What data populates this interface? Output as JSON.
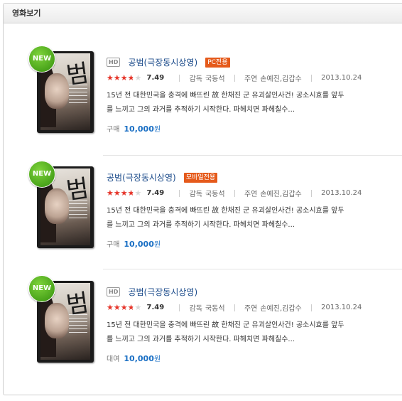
{
  "panel": {
    "title": "영화보기"
  },
  "colors": {
    "star": "#e8352a",
    "new_badge": "#4aa41b",
    "tag": "#e55a1b",
    "link": "#1a4a8a",
    "price": "#1a6fc4"
  },
  "items": [
    {
      "badge": "NEW",
      "hd": "HD",
      "title": "공범(극장동시상영)",
      "tag": "PC전용",
      "rating": 7.49,
      "rating_text": "7.49",
      "director_label": "감독",
      "director": "국동석",
      "cast_label": "주연",
      "cast": "손예진,김갑수",
      "date": "2013.10.24",
      "desc_line1": "15년 전 대한민국을 충격에 빠뜨린 故 한채진 군 유괴살인사건! 공소시효를 앞두",
      "desc_line2": "를 느끼고 그의 과거를 추적하기 시작한다. 파헤치면 파헤칠수...",
      "price_label": "구매",
      "price": "10,000",
      "price_unit": "원"
    },
    {
      "badge": "NEW",
      "hd": "",
      "title": "공범(극장동시상영)",
      "tag": "모바일전용",
      "rating": 7.49,
      "rating_text": "7.49",
      "director_label": "감독",
      "director": "국동석",
      "cast_label": "주연",
      "cast": "손예진,김갑수",
      "date": "2013.10.24",
      "desc_line1": "15년 전 대한민국을 충격에 빠뜨린 故 한채진 군 유괴살인사건! 공소시효를 앞두",
      "desc_line2": "를 느끼고 그의 과거를 추적하기 시작한다. 파헤치면 파헤칠수...",
      "price_label": "구매",
      "price": "10,000",
      "price_unit": "원"
    },
    {
      "badge": "NEW",
      "hd": "HD",
      "title": "공범(극장동시상영)",
      "tag": "",
      "rating": 7.49,
      "rating_text": "7.49",
      "director_label": "감독",
      "director": "국동석",
      "cast_label": "주연",
      "cast": "손예진,김갑수",
      "date": "2013.10.24",
      "desc_line1": "15년 전 대한민국을 충격에 빠뜨린 故 한채진 군 유괴살인사건! 공소시효를 앞두",
      "desc_line2": "를 느끼고 그의 과거를 추적하기 시작한다. 파헤치면 파헤칠수...",
      "price_label": "대여",
      "price": "10,000",
      "price_unit": "원"
    }
  ]
}
